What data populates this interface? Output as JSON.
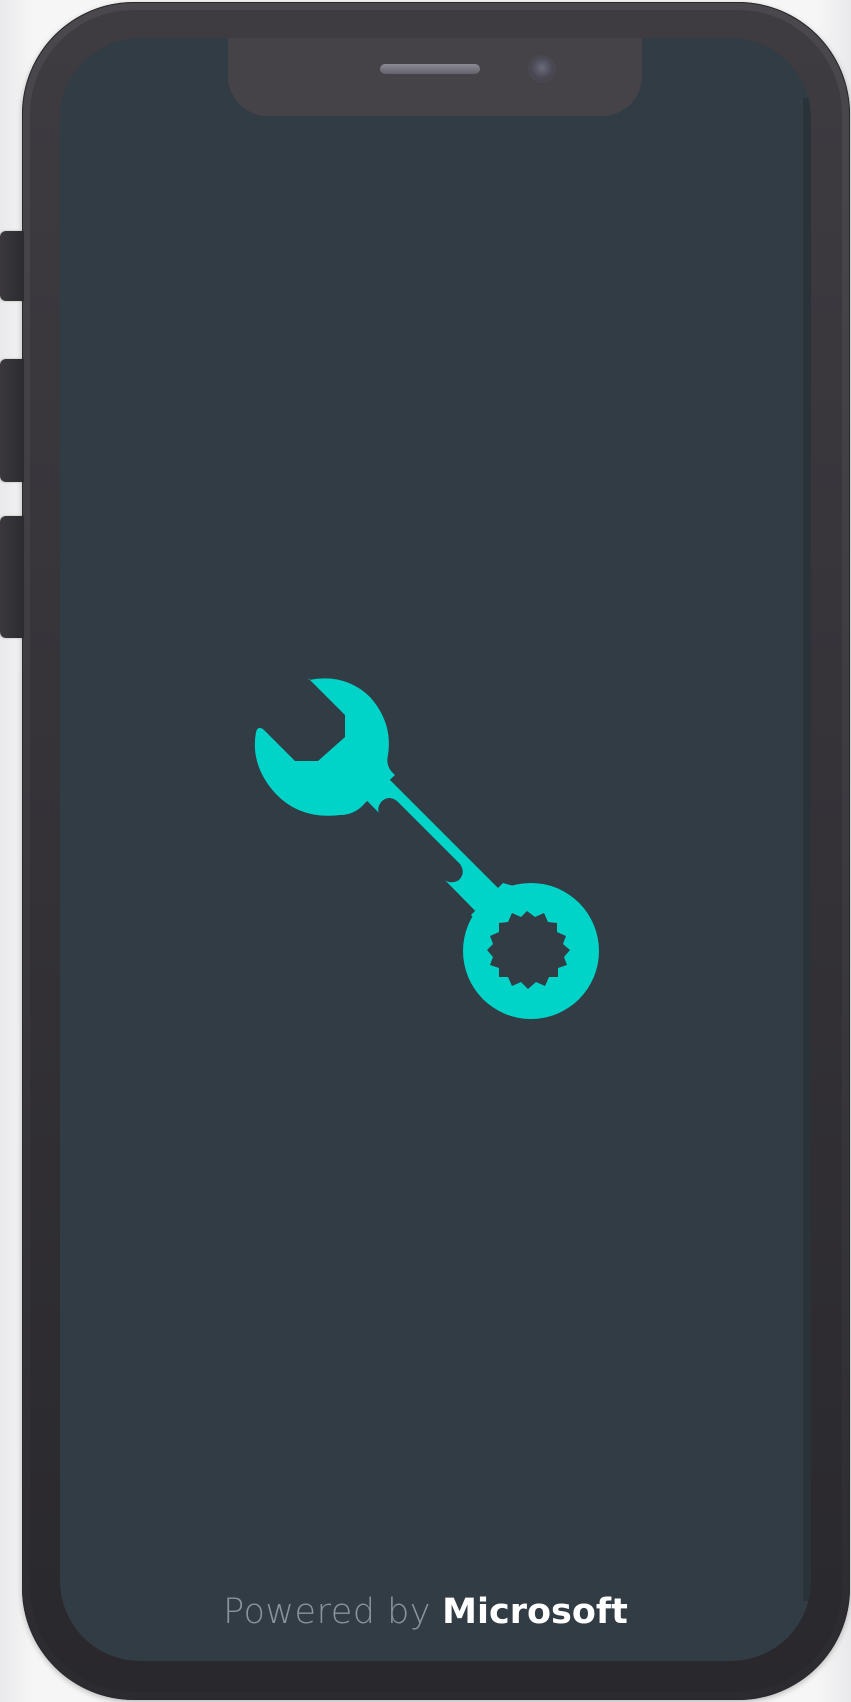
{
  "footer": {
    "powered_by": "Powered by",
    "brand": "Microsoft"
  },
  "colors": {
    "screen_background": "#323c45",
    "accent": "#00d4c8",
    "device_frame": "#3d3b40"
  },
  "icons": {
    "main": "wrench-icon"
  }
}
